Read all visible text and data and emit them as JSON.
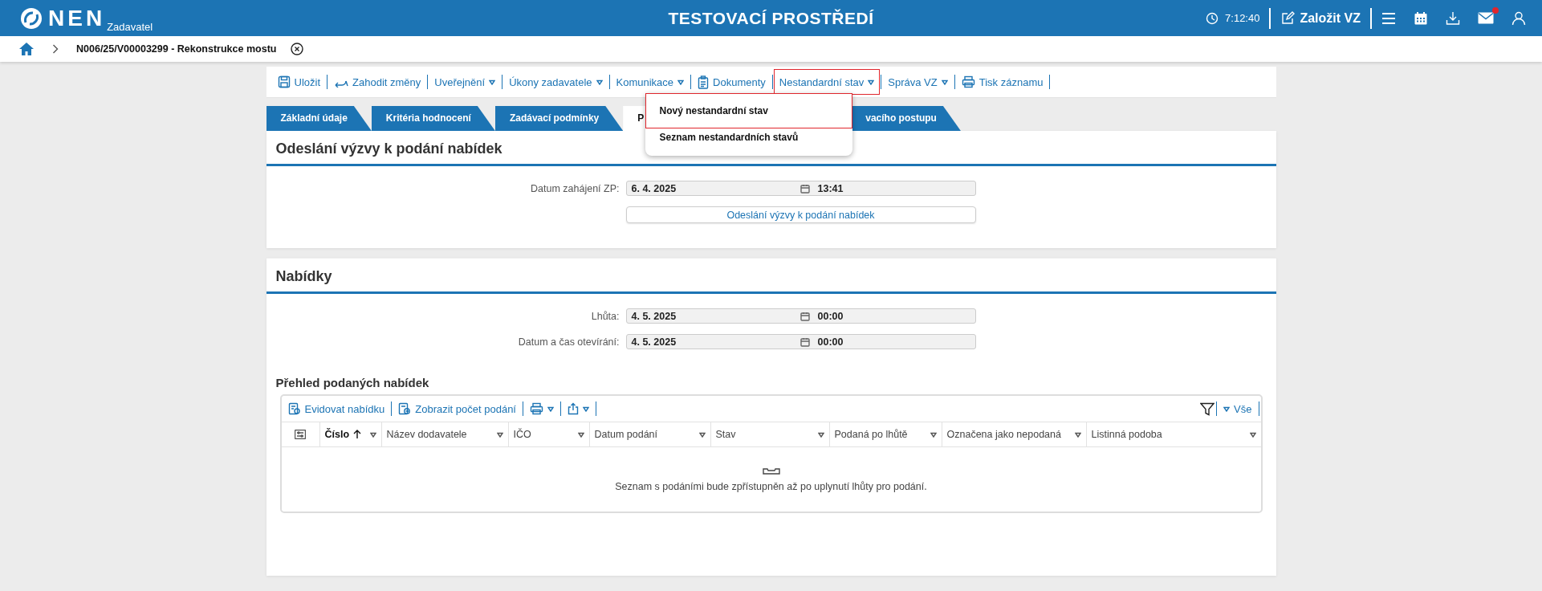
{
  "header": {
    "logo_text": "NEN",
    "logo_subtitle": "Zadavatel",
    "environment": "TESTOVACÍ PROSTŘEDÍ",
    "time": "7:12:40",
    "create_button": "Založit VZ",
    "mail_unread": true
  },
  "breadcrumb": {
    "title": "N006/25/V00003299 - Rekonstrukce mostu"
  },
  "toolbar": [
    {
      "label": "Uložit",
      "kind": "save",
      "highlighted": false
    },
    {
      "label": "Zahodit změny",
      "kind": "discard",
      "highlighted": false
    },
    {
      "label": "Uveřejnění",
      "kind": "dropdown",
      "highlighted": false
    },
    {
      "label": "Úkony zadavatele",
      "kind": "dropdown",
      "highlighted": false
    },
    {
      "label": "Komunikace",
      "kind": "dropdown",
      "highlighted": false
    },
    {
      "label": "Dokumenty",
      "kind": "documents",
      "highlighted": false
    },
    {
      "label": "Nestandardní stav",
      "kind": "dropdown",
      "highlighted": true
    },
    {
      "label": "Správa VZ",
      "kind": "dropdown",
      "highlighted": false
    },
    {
      "label": "Tisk záznamu",
      "kind": "print",
      "highlighted": false
    }
  ],
  "dropdown_menu": {
    "items": [
      {
        "label": "Nový nestandardní stav",
        "highlighted": true
      },
      {
        "label": "Seznam nestandardních stavů",
        "highlighted": false
      }
    ]
  },
  "tabs": [
    {
      "label": "Základní údaje",
      "selected": false
    },
    {
      "label": "Kritéria hodnocení",
      "selected": false
    },
    {
      "label": "Zadávací podmínky",
      "selected": false
    },
    {
      "label": "P",
      "selected": true
    },
    {
      "label": "vacího postupu",
      "selected": false
    }
  ],
  "invitation_section": {
    "title": "Odeslání výzvy k podání nabídek",
    "fields": [
      {
        "label": "Datum zahájení ZP:",
        "date": "6. 4. 2025",
        "time": "13:41"
      }
    ],
    "button": "Odeslání výzvy k podání nabídek"
  },
  "offers_section": {
    "title": "Nabídky",
    "fields": [
      {
        "label": "Lhůta:",
        "date": "4. 5. 2025",
        "time": "00:00"
      },
      {
        "label": "Datum a čas otevírání:",
        "date": "4. 5. 2025",
        "time": "00:00"
      }
    ],
    "table_title": "Přehled podaných nabídek",
    "table": {
      "toolbar": [
        {
          "label": "Evidovat nabídku",
          "kind": "register"
        },
        {
          "label": "Zobrazit počet podání",
          "kind": "count"
        },
        {
          "kind": "print"
        },
        {
          "kind": "export"
        }
      ],
      "filter_label": "Vše",
      "columns": [
        {
          "label": "Číslo",
          "sorted": true
        },
        {
          "label": "Název dodavatele",
          "sorted": false
        },
        {
          "label": "IČO",
          "sorted": false
        },
        {
          "label": "Datum podání",
          "sorted": false
        },
        {
          "label": "Stav",
          "sorted": false
        },
        {
          "label": "Podaná po lhůtě",
          "sorted": false
        },
        {
          "label": "Označena jako nepodaná",
          "sorted": false
        },
        {
          "label": "Listinná podoba",
          "sorted": false
        }
      ],
      "empty_message": "Seznam s podáními bude zpřístupněn až po uplynutí lhůty pro podání."
    }
  }
}
